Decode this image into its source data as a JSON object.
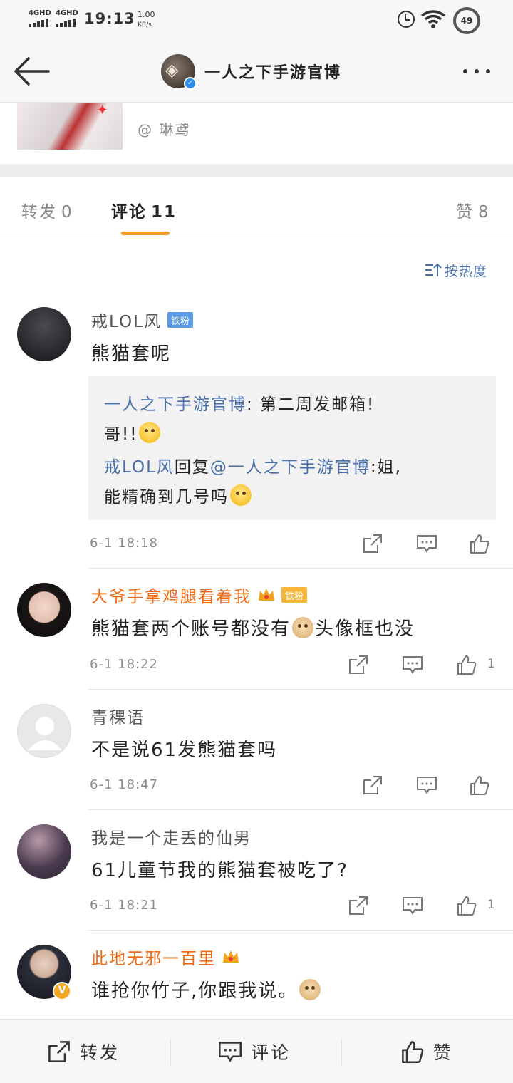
{
  "status_bar": {
    "network_1": "4GHD",
    "network_2": "4GHD",
    "time": "19:13",
    "speed_value": "1.00",
    "speed_unit": "KB/s",
    "battery": "49"
  },
  "header": {
    "title": "一人之下手游官博",
    "back_icon": "arrow-left-icon",
    "more_icon": "more-dots-icon"
  },
  "retweet_card": {
    "author": "@ 琳鸢"
  },
  "tabs": {
    "forward_label": "转发",
    "forward_count": "0",
    "comment_label": "评论",
    "comment_count": "11",
    "like_label": "赞",
    "like_count": "8"
  },
  "sort": {
    "label": "按热度"
  },
  "comments": [
    {
      "name": "戒LOL风",
      "badge": "铁粉",
      "body": "熊猫套呢",
      "time": "6-1 18:18",
      "likes": "",
      "quote": {
        "line1_link": "一人之下手游官博",
        "line1_text": ": 第二周发邮箱!",
        "line2_text": "哥!!",
        "line3_link": "戒LOL风",
        "line3_text": "回复",
        "line3_mention": "@一人之下手游官博",
        "line3_tail": ":姐,",
        "line4_text": "能精确到几号吗"
      }
    },
    {
      "name": "大爷手拿鸡腿看着我",
      "badge": "铁粉",
      "body_a": "熊猫套两个账号都没有",
      "body_b": "头像框也没",
      "time": "6-1 18:22",
      "likes": "1"
    },
    {
      "name": "青稞语",
      "body": "不是说61发熊猫套吗",
      "time": "6-1 18:47",
      "likes": ""
    },
    {
      "name": "我是一个走丢的仙男",
      "body": "61儿童节我的熊猫套被吃了?",
      "time": "6-1 18:21",
      "likes": "1"
    },
    {
      "name": "此地无邪一百里",
      "body": "谁抢你竹子,你跟我说。"
    }
  ],
  "bottom_bar": {
    "forward": "转发",
    "comment": "评论",
    "like": "赞"
  },
  "colors": {
    "accent_orange": "#f29b1f",
    "link_blue": "#476ea8",
    "vip_orange": "#ef6a11"
  }
}
